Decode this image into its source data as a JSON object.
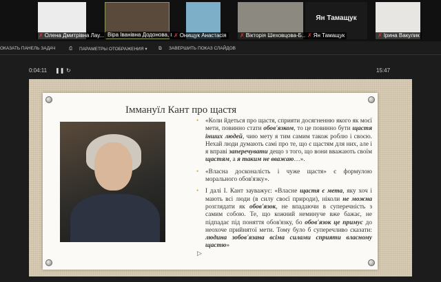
{
  "participants": [
    {
      "name": "Олена Дмитрівна Лау..."
    },
    {
      "name": "Віра Іванівна Додонова, г..."
    },
    {
      "name": "Онищук Анастасія"
    },
    {
      "name": "Вікторія Шеховцова-Б..."
    },
    {
      "name": "Ян Тамащук",
      "display": "Ян Тамащук"
    },
    {
      "name": "Ірина Вакулик"
    }
  ],
  "toolbar": {
    "show_taskbar": "ОКАЗАТЬ ПАНЕЛЬ ЗАДАЧ",
    "display_settings": "ПАРАМЕТРЫ ОТОБРАЖЕНИЯ ▾",
    "end_show": "ЗАВЕРШИТЬ ПОКАЗ СЛАЙДОВ"
  },
  "presenter": {
    "timer": "0:04:11",
    "pause": "❚❚",
    "restart": "↻",
    "clock": "15:47"
  },
  "slide": {
    "title": "Іммануїл Кант про щастя",
    "paragraphs": [
      [
        {
          "t": "«Коли йдеться про щастя, сприяти досягненню якого як моєї мети, повинно стати "
        },
        {
          "t": "обов'язком",
          "b": true
        },
        {
          "t": ", то це повинно бути "
        },
        {
          "t": "щастя інших людей",
          "b": true
        },
        {
          "t": ", чию мету я тим самим також роблю і своєю. Нехай люди думають самі про те, що є щастям для них, але і я вправі "
        },
        {
          "t": "заперечувати",
          "b": true
        },
        {
          "t": " дещо з того, що вони вважають своїм "
        },
        {
          "t": "щастям",
          "b": true
        },
        {
          "t": ", а "
        },
        {
          "t": "я таким не вважаю",
          "b": true
        },
        {
          "t": "…»."
        }
      ],
      [
        {
          "t": "«Власна досконалість і чуже щастя» є формулою морального обов'язку»."
        }
      ],
      [
        {
          "t": "І далі І. Кант зауважує: «Власне "
        },
        {
          "t": "щастя є мета",
          "b": true
        },
        {
          "t": ", яку хоч і мають всі люди (в силу своєї природи), ніколи "
        },
        {
          "t": "не можна",
          "b": true
        },
        {
          "t": " розглядати як "
        },
        {
          "t": "обов'язок",
          "b": true
        },
        {
          "t": ", не впадаючи в суперечність з самим собою. Те, що кожний неминуче вже бажає, не підпадає під поняття обов'язку, бо "
        },
        {
          "t": "обов'язок це примус",
          "b": true
        },
        {
          "t": " до неохоче прийнятої мети. Тому було б суперечливо сказати: "
        },
        {
          "t": "людина зобов'язана всіма силами сприяти власному щастю",
          "b": true
        },
        {
          "t": "»"
        }
      ]
    ]
  }
}
